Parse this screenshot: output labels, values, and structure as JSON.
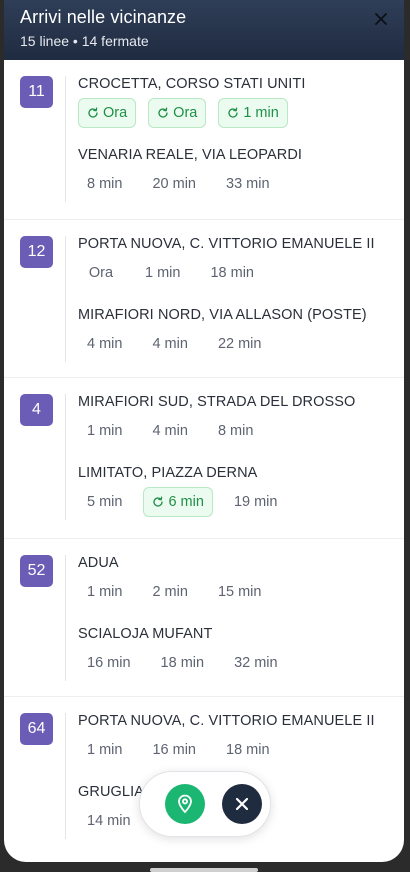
{
  "header": {
    "title": "Arrivi nelle vicinanze",
    "subtitle": "15 linee • 14 fermate"
  },
  "groups": [
    {
      "line": "11",
      "stops": [
        {
          "destination": "CROCETTA, CORSO STATI UNITI",
          "times": [
            {
              "label": "Ora",
              "live": true
            },
            {
              "label": "Ora",
              "live": true
            },
            {
              "label": "1 min",
              "live": true
            }
          ]
        },
        {
          "destination": "VENARIA REALE, VIA LEOPARDI",
          "times": [
            {
              "label": "8 min",
              "live": false
            },
            {
              "label": "20 min",
              "live": false
            },
            {
              "label": "33 min",
              "live": false
            }
          ]
        }
      ]
    },
    {
      "line": "12",
      "stops": [
        {
          "destination": "PORTA NUOVA, C. VITTORIO EMANUELE II",
          "times": [
            {
              "label": "Ora",
              "live": false
            },
            {
              "label": "1 min",
              "live": false
            },
            {
              "label": "18 min",
              "live": false
            }
          ]
        },
        {
          "destination": "MIRAFIORI NORD, VIA ALLASON (POSTE)",
          "times": [
            {
              "label": "4 min",
              "live": false
            },
            {
              "label": "4 min",
              "live": false
            },
            {
              "label": "22 min",
              "live": false
            }
          ]
        }
      ]
    },
    {
      "line": "4",
      "stops": [
        {
          "destination": "MIRAFIORI SUD, STRADA DEL DROSSO",
          "times": [
            {
              "label": "1 min",
              "live": false
            },
            {
              "label": "4 min",
              "live": false
            },
            {
              "label": "8 min",
              "live": false
            }
          ]
        },
        {
          "destination": "LIMITATO, PIAZZA DERNA",
          "times": [
            {
              "label": "5 min",
              "live": false
            },
            {
              "label": "6 min",
              "live": true
            },
            {
              "label": "19 min",
              "live": false
            }
          ]
        }
      ]
    },
    {
      "line": "52",
      "stops": [
        {
          "destination": "ADUA",
          "times": [
            {
              "label": "1 min",
              "live": false
            },
            {
              "label": "2 min",
              "live": false
            },
            {
              "label": "15 min",
              "live": false
            }
          ]
        },
        {
          "destination": "SCIALOJA MUFANT",
          "times": [
            {
              "label": "16 min",
              "live": false
            },
            {
              "label": "18 min",
              "live": false
            },
            {
              "label": "32 min",
              "live": false
            }
          ]
        }
      ]
    },
    {
      "line": "64",
      "stops": [
        {
          "destination": "PORTA NUOVA, C. VITTORIO EMANUELE II",
          "times": [
            {
              "label": "1 min",
              "live": false
            },
            {
              "label": "16 min",
              "live": false
            },
            {
              "label": "18 min",
              "live": false
            }
          ]
        },
        {
          "destination": "GRUGLIA",
          "times": [
            {
              "label": "14 min",
              "live": false
            },
            {
              "label": "",
              "live": false
            },
            {
              "label": "min",
              "live": false
            }
          ]
        }
      ]
    }
  ],
  "colors": {
    "header_bg": "#26334b",
    "line_badge": "#6b5cb5",
    "live_chip_bg": "#ecfbef",
    "live_chip_text": "#1f8f48",
    "locate_button": "#1cb673",
    "close_button": "#1f2b3e"
  },
  "icons": {
    "header_close": "close-icon",
    "realtime": "refresh-icon",
    "locate": "map-pin-icon",
    "dismiss": "close-icon"
  }
}
